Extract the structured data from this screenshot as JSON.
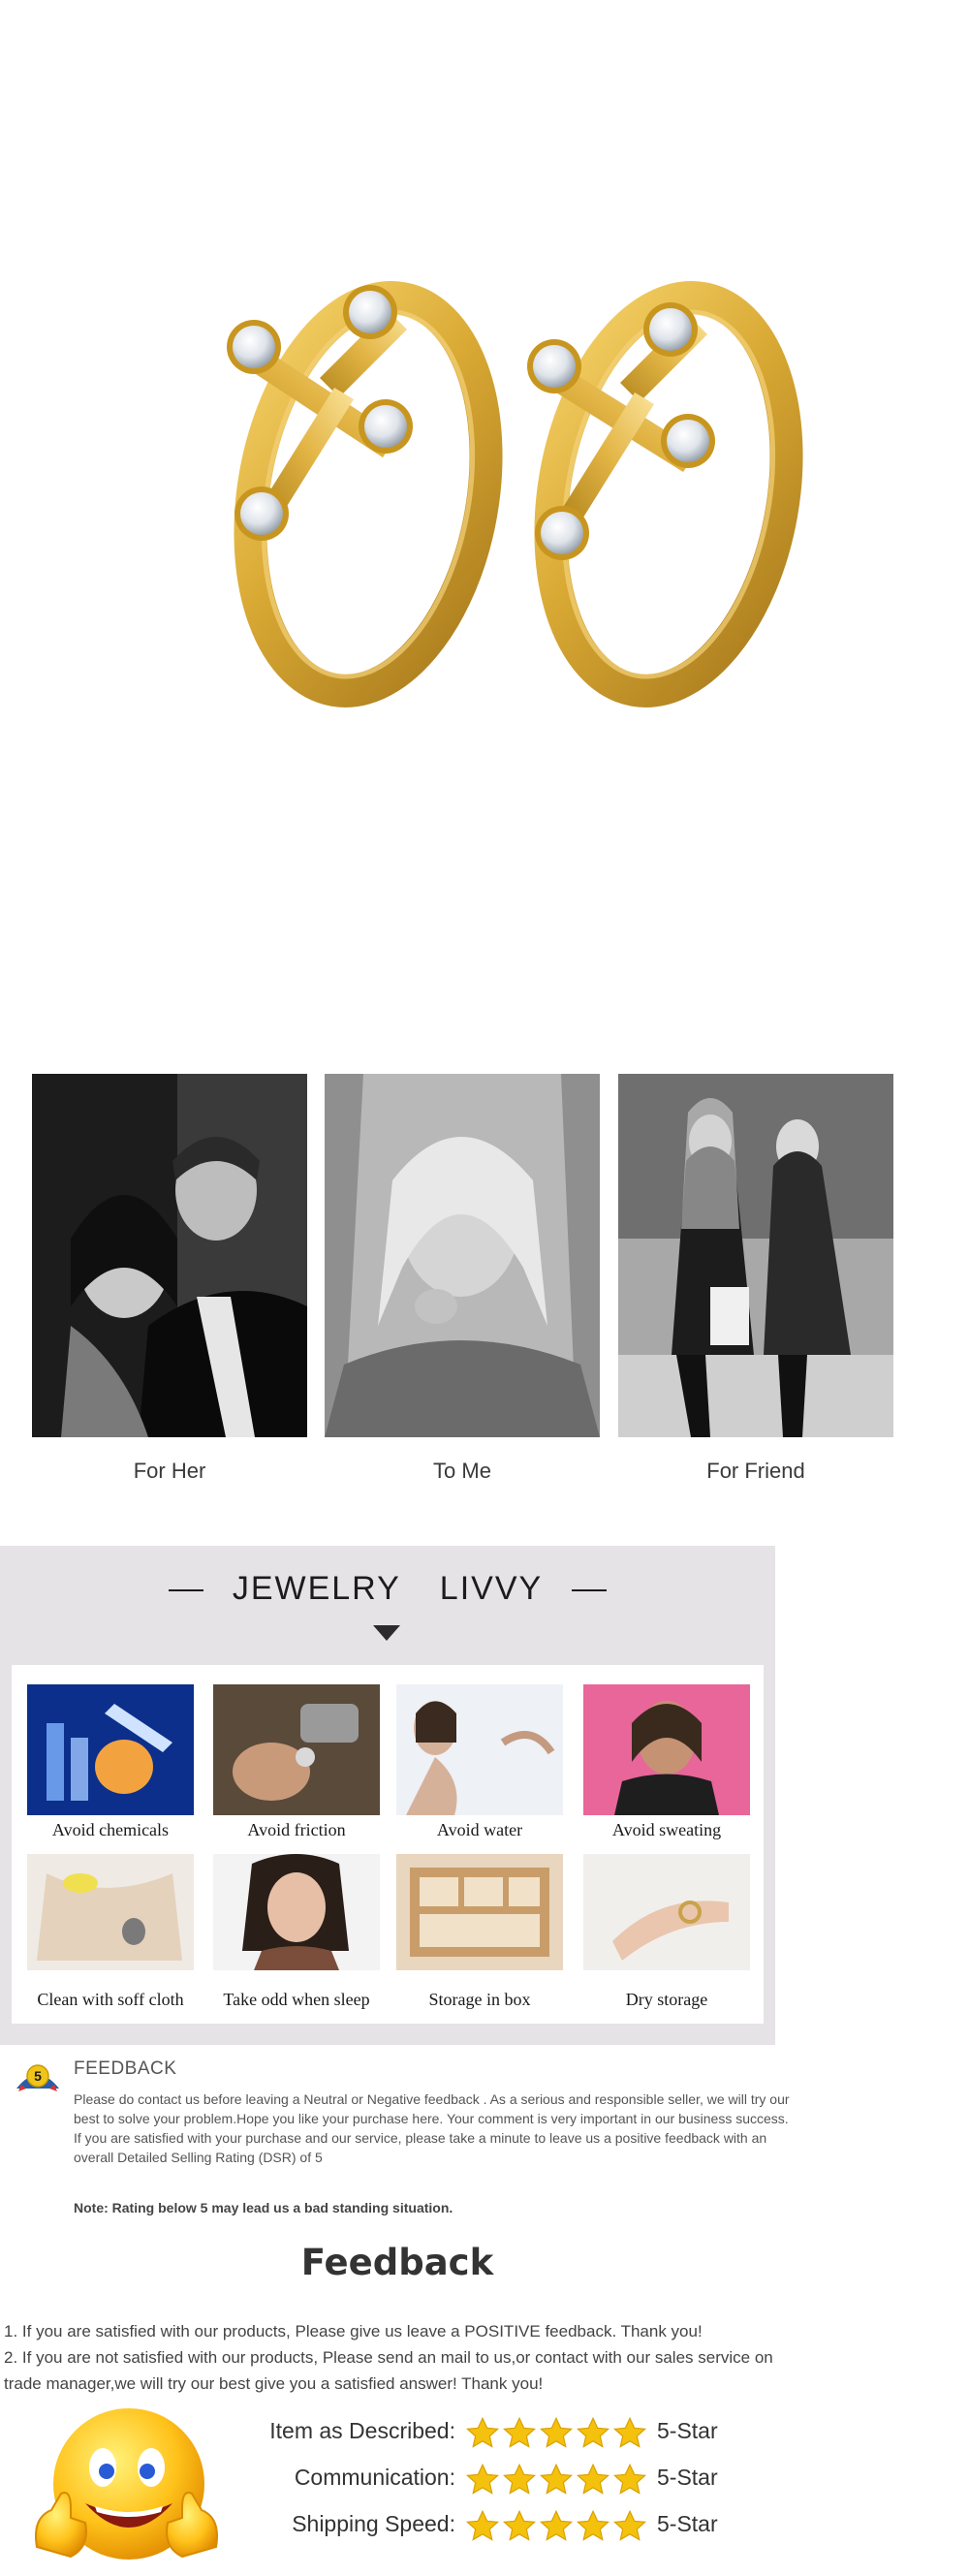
{
  "gift": {
    "items": [
      {
        "caption": "For Her"
      },
      {
        "caption": "To Me"
      },
      {
        "caption": "For Friend"
      }
    ]
  },
  "care": {
    "brand_left": "JEWELRY",
    "brand_right": "LIVVY",
    "tips": [
      {
        "label": "Avoid chemicals"
      },
      {
        "label": "Avoid friction"
      },
      {
        "label": "Avoid water"
      },
      {
        "label": "Avoid sweating"
      },
      {
        "label": "Clean with soff cloth"
      },
      {
        "label": "Take odd when sleep"
      },
      {
        "label": "Storage in box"
      },
      {
        "label": "Dry storage"
      }
    ]
  },
  "feedback_notice": {
    "logo_text": "5",
    "title": "FEEDBACK",
    "paragraphs": [
      "Please do contact us before leaving a Neutral or Negative  feedback . As a serious and responsible seller, we will try our best to solve your problem.Hope you like your purchase here. Your comment is very important in our business success.",
      " If you are satisfied with your purchase and our service,  please take a minute to leave us  a positive feedback with an overall  Detailed Selling Rating (DSR) of 5"
    ],
    "note": "Note: Rating below 5 may lead us a bad standing situation."
  },
  "feedback_rating": {
    "heading": "Feedback",
    "lines": [
      "1. If you are satisfied with our products, Please give us leave a POSITIVE feedback. Thank you!",
      "2. If you are not satisfied with our products, Please send an mail to us,or contact with our sales service on trade manager,we will try our best give you a satisfied answer! Thank you!"
    ],
    "ratings": [
      {
        "label": "Item as Described:",
        "stars": 5,
        "value": "5-Star"
      },
      {
        "label": "Communication:",
        "stars": 5,
        "value": "5-Star"
      },
      {
        "label": "Shipping Speed:",
        "stars": 5,
        "value": "5-Star"
      }
    ]
  },
  "colors": {
    "gold": "#d9a934",
    "care_background": "#e6e3e7",
    "star": "#f4c20d"
  }
}
